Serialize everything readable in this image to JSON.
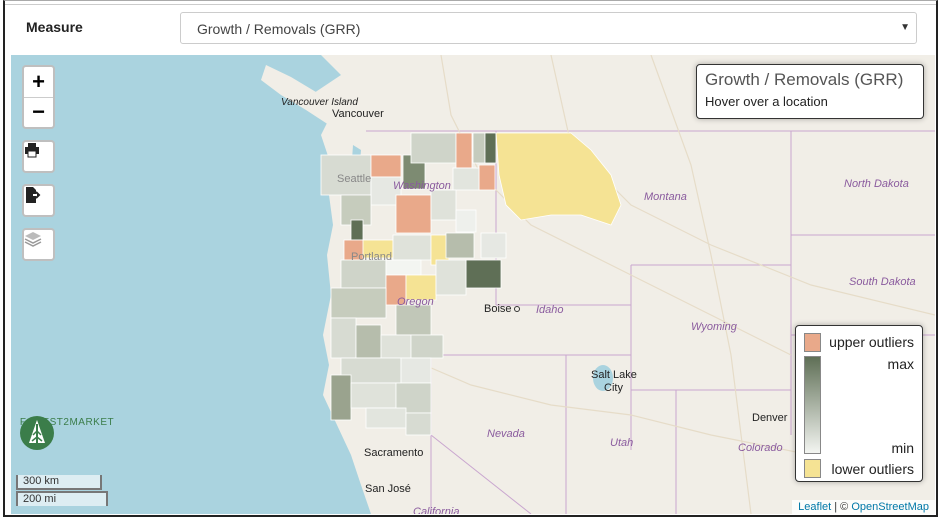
{
  "header": {
    "measure_label": "Measure",
    "measure_value": "Growth / Removals (GRR)"
  },
  "map": {
    "zoom_in": "+",
    "zoom_out": "−",
    "info": {
      "title": "Growth / Removals (GRR)",
      "hint": "Hover over a location"
    },
    "legend": {
      "upper": "upper outliers",
      "max": "max",
      "min": "min",
      "lower": "lower outliers",
      "colors": {
        "upper": "#e9a98a",
        "max": "#5f6f56",
        "min": "#f3f5f1",
        "lower": "#f5e394"
      }
    },
    "attribution": {
      "leaflet": "Leaflet",
      "sep": " | © ",
      "osm": "OpenStreetMap"
    },
    "scale": {
      "km": "300 km",
      "mi": "200 mi"
    },
    "logo_text": "FOREST2MARKET",
    "places": {
      "vancouver_island": "Vancouver Island",
      "vancouver": "Vancouver",
      "seattle": "Seattle",
      "washington": "Washington",
      "portland": "Portland",
      "oregon": "Oregon",
      "boise": "Boise",
      "idaho": "Idaho",
      "montana": "Montana",
      "north_dakota": "North Dakota",
      "south_dakota": "South Dakota",
      "wyoming": "Wyoming",
      "nevada": "Nevada",
      "utah": "Utah",
      "colorado": "Colorado",
      "sacramento": "Sacramento",
      "san_jose": "San José",
      "salt_lake_city_1": "Salt Lake",
      "salt_lake_city_2": "City",
      "denver": "Denver",
      "california": "California"
    }
  }
}
